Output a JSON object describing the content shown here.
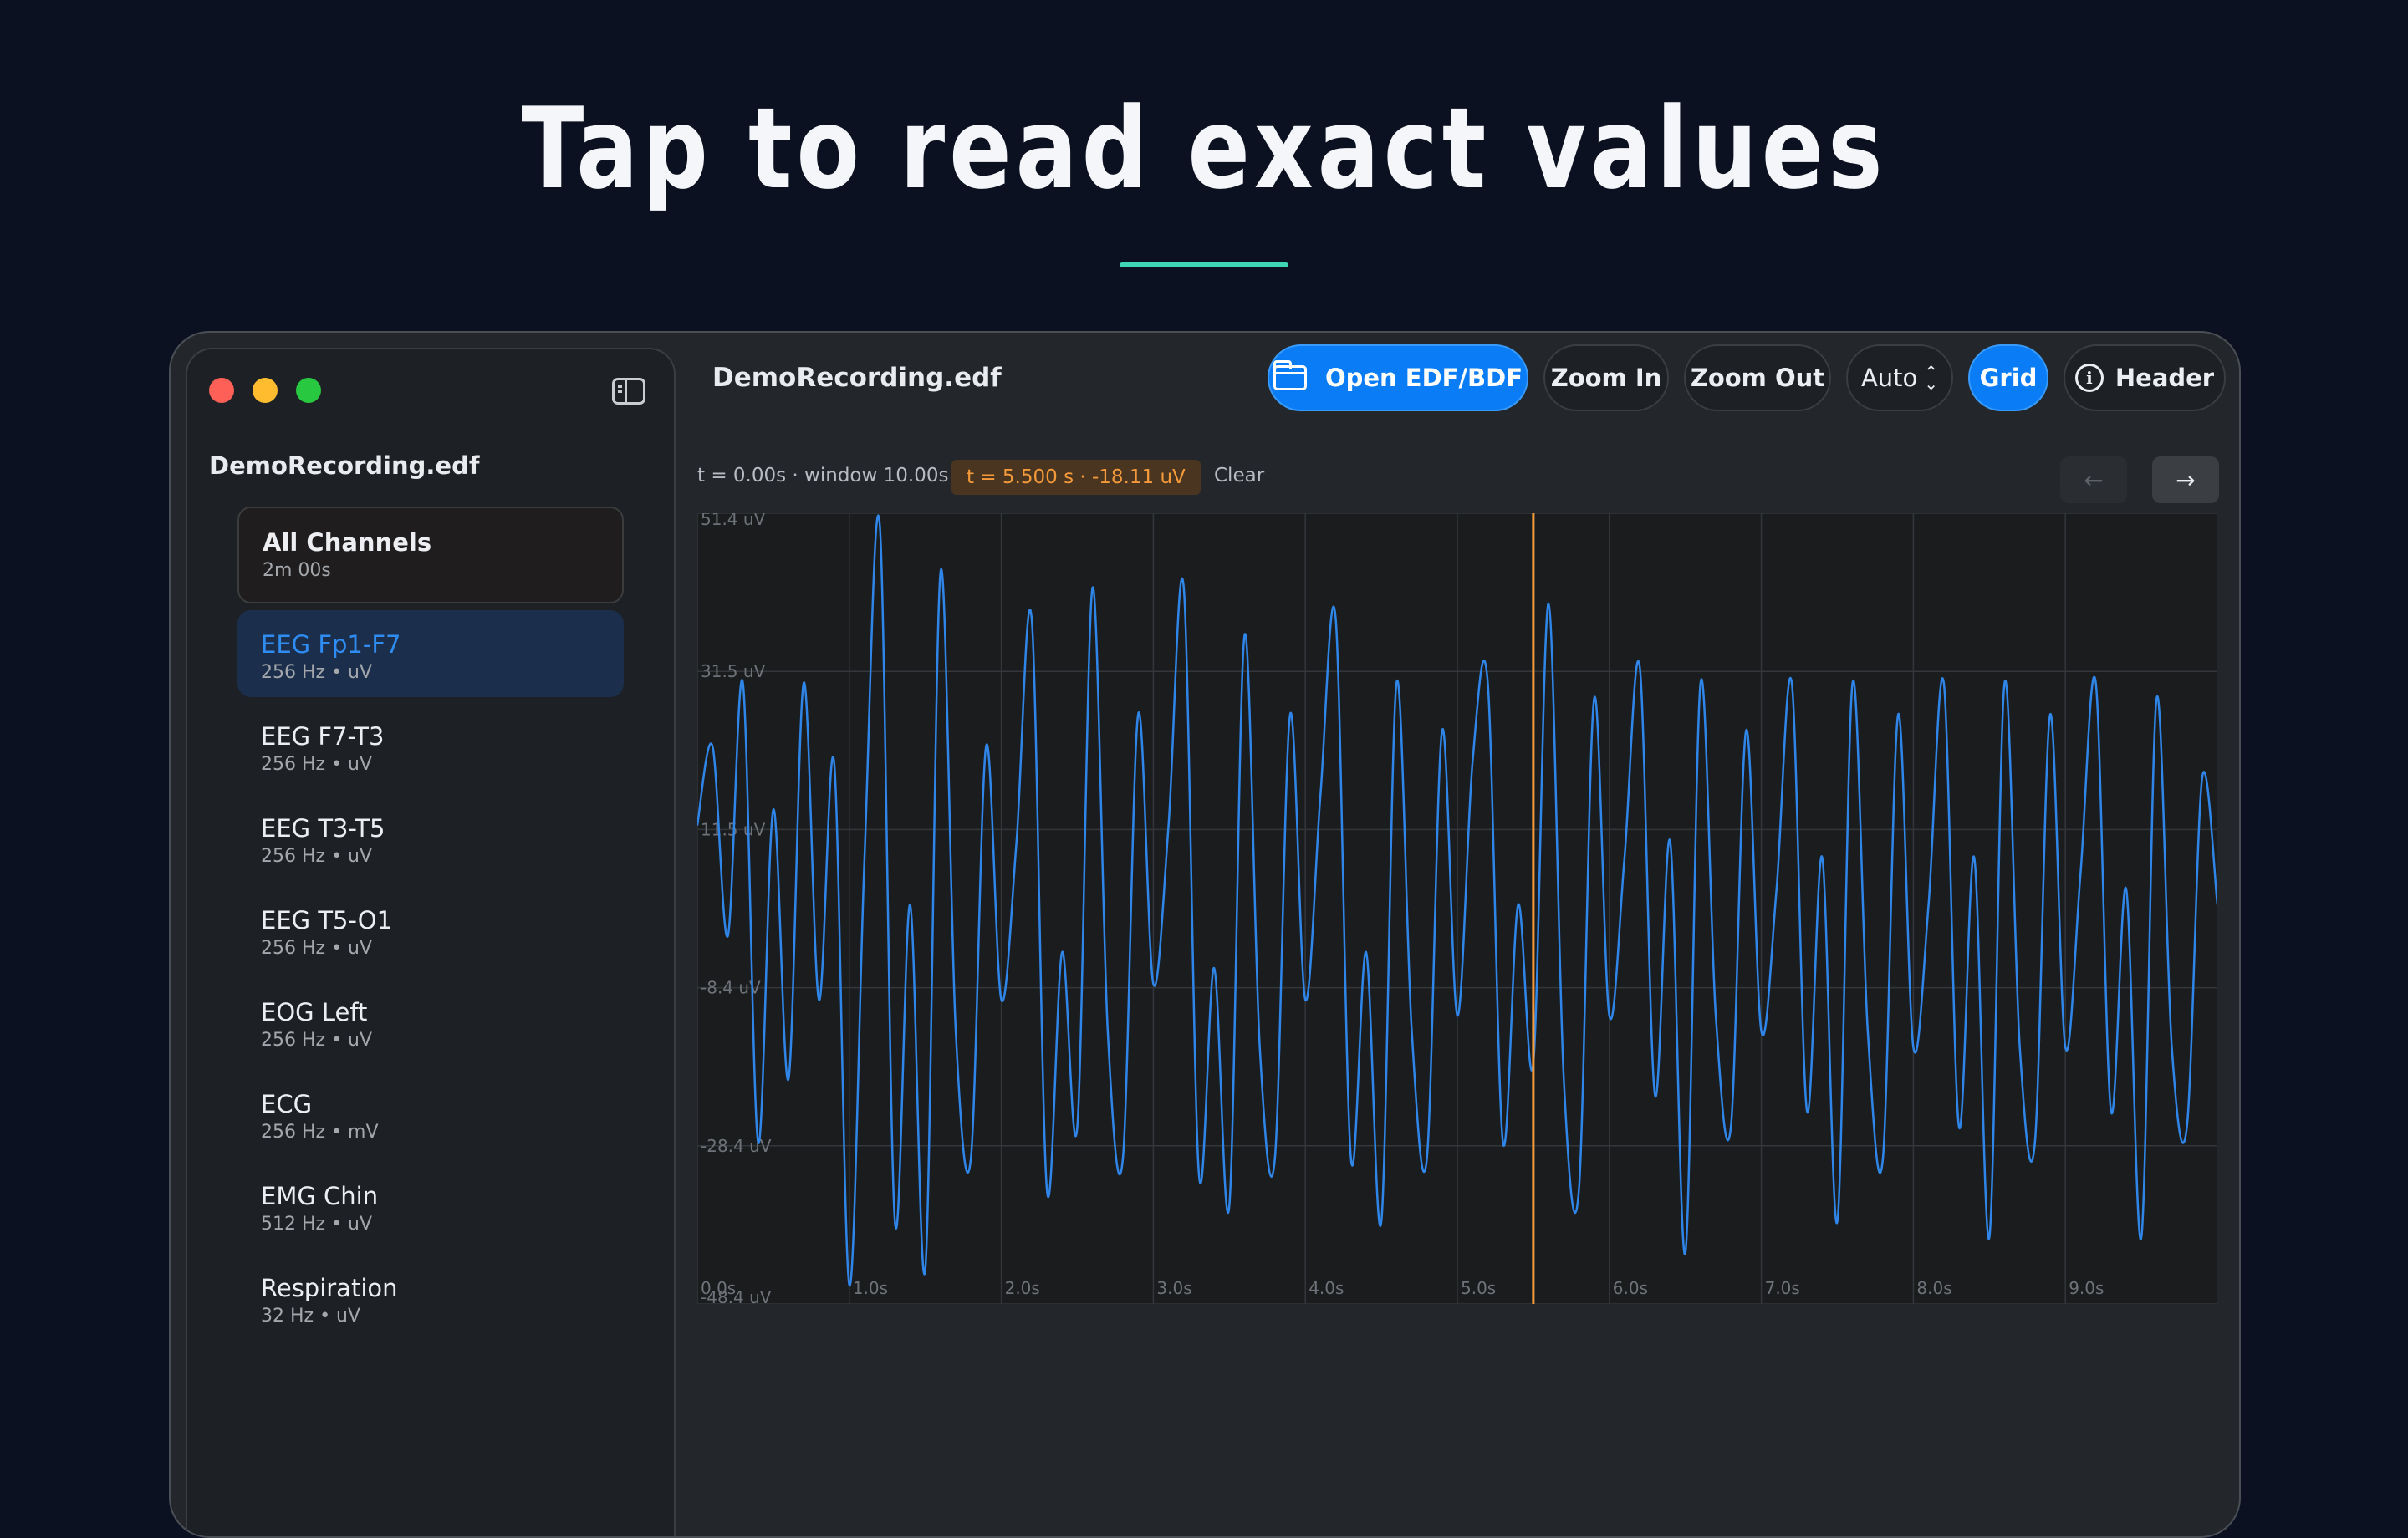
{
  "headline": "Tap to read exact values",
  "window": {
    "title": "DemoRecording.edf",
    "toolbar": {
      "open_label": "Open EDF/BDF",
      "zoom_in_label": "Zoom In",
      "zoom_out_label": "Zoom Out",
      "scale_label": "Auto",
      "grid_label": "Grid",
      "header_label": "Header"
    },
    "status": {
      "time_window": "t = 0.00s · window 10.00s",
      "cursor_readout": "t = 5.500 s · -18.11 uV",
      "clear_label": "Clear",
      "prev_label": "←",
      "next_label": "→"
    }
  },
  "sidebar": {
    "file_name": "DemoRecording.edf",
    "channels": [
      {
        "name": "All Channels",
        "meta": "2m 00s"
      },
      {
        "name": "EEG Fp1-F7",
        "meta": "256 Hz • uV",
        "selected": true
      },
      {
        "name": "EEG F7-T3",
        "meta": "256 Hz • uV"
      },
      {
        "name": "EEG T3-T5",
        "meta": "256 Hz • uV"
      },
      {
        "name": "EEG T5-O1",
        "meta": "256 Hz • uV"
      },
      {
        "name": "EOG Left",
        "meta": "256 Hz • uV"
      },
      {
        "name": "ECG",
        "meta": "256 Hz • mV"
      },
      {
        "name": "EMG Chin",
        "meta": "512 Hz • uV"
      },
      {
        "name": "Respiration",
        "meta": "32 Hz • uV"
      }
    ]
  },
  "colors": {
    "accent": "#0a7cf5",
    "trace": "#2f86e8",
    "cursor": "#f59a3a",
    "teal_rule": "#3fd6b4"
  },
  "chart_data": {
    "type": "line",
    "xlabel": "",
    "ylabel": "",
    "xlim": [
      0,
      10
    ],
    "ylim": [
      -48.4,
      51.4
    ],
    "x_ticks": [
      "0.0s",
      "1.0s",
      "2.0s",
      "3.0s",
      "4.0s",
      "5.0s",
      "6.0s",
      "7.0s",
      "8.0s",
      "9.0s"
    ],
    "y_ticks": [
      "51.4 uV",
      "31.5 uV",
      "11.5 uV",
      "-8.4 uV",
      "-28.4 uV",
      "-48.4 uV"
    ],
    "grid": true,
    "cursor_x": 5.5,
    "cursor_value": -18.11,
    "series": [
      {
        "name": "EEG Fp1-F7",
        "x": [
          0.0,
          0.1,
          0.2,
          0.3,
          0.4,
          0.5,
          0.6,
          0.7,
          0.8,
          0.9,
          1.0,
          1.1,
          1.2,
          1.3,
          1.4,
          1.5,
          1.6,
          1.7,
          1.8,
          1.9,
          2.0,
          2.1,
          2.2,
          2.3,
          2.4,
          2.5,
          2.6,
          2.7,
          2.8,
          2.9,
          3.0,
          3.1,
          3.2,
          3.3,
          3.4,
          3.5,
          3.6,
          3.7,
          3.8,
          3.9,
          4.0,
          4.1,
          4.2,
          4.3,
          4.4,
          4.5,
          4.6,
          4.7,
          4.8,
          4.9,
          5.0,
          5.1,
          5.2,
          5.3,
          5.4,
          5.5,
          5.6,
          5.7,
          5.8,
          5.9,
          6.0,
          6.1,
          6.2,
          6.3,
          6.4,
          6.5,
          6.6,
          6.7,
          6.8,
          6.9,
          7.0,
          7.1,
          7.2,
          7.3,
          7.4,
          7.5,
          7.6,
          7.7,
          7.8,
          7.9,
          8.0,
          8.1,
          8.2,
          8.3,
          8.4,
          8.5,
          8.6,
          8.7,
          8.8,
          8.9,
          9.0,
          9.1,
          9.2,
          9.3,
          9.4,
          9.5,
          9.6,
          9.7,
          9.8,
          9.9,
          10.0
        ],
        "values": [
          12,
          22,
          -2,
          30,
          -28,
          14,
          -20,
          30,
          -10,
          20,
          -46,
          8,
          50,
          -38,
          2,
          -44,
          44,
          -14,
          -30,
          22,
          -10,
          10,
          38,
          -34,
          -4,
          -26,
          42,
          -14,
          -30,
          26,
          -8,
          12,
          42,
          -32,
          -6,
          -36,
          36,
          -16,
          -30,
          26,
          -10,
          16,
          38,
          -30,
          -4,
          -38,
          30,
          -14,
          -30,
          24,
          -12,
          20,
          30,
          -28,
          2,
          -18,
          40,
          -20,
          -34,
          28,
          -12,
          8,
          32,
          -22,
          10,
          -42,
          30,
          -12,
          -26,
          24,
          -14,
          4,
          30,
          -24,
          8,
          -38,
          30,
          -14,
          -30,
          26,
          -16,
          2,
          30,
          -26,
          8,
          -40,
          30,
          -16,
          -28,
          26,
          -16,
          6,
          30,
          -24,
          4,
          -40,
          28,
          -16,
          -26,
          18,
          2
        ]
      }
    ]
  }
}
